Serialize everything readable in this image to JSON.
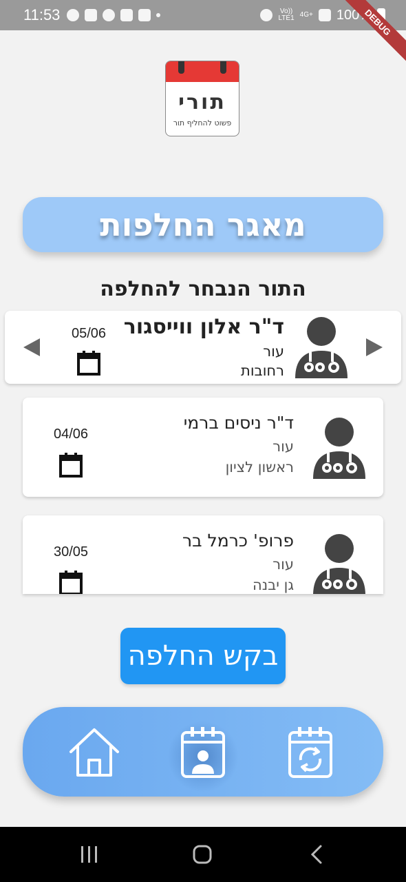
{
  "status_bar": {
    "time": "11:53",
    "battery": "100%",
    "network_top": "Vo))",
    "network_bottom": "LTE1",
    "network_type": "4G+"
  },
  "debug_banner": "DEBUG",
  "logo": {
    "text": "תורי",
    "tagline": "פשוט להחליף תור"
  },
  "title": "מאגר החלפות",
  "selected_heading": "התור הנבחר להחלפה",
  "selected_appointment": {
    "doctor": "ד\"ר אלון ווייסגור",
    "specialty": "עור",
    "city": "רחובות",
    "date": "05/06"
  },
  "appointments": [
    {
      "doctor": "ד\"ר ניסים ברמי",
      "specialty": "עור",
      "city": "ראשון לציון",
      "date": "04/06"
    },
    {
      "doctor": "פרופ' כרמל בר",
      "specialty": "עור",
      "city": "גן יבנה",
      "date": "30/05"
    }
  ],
  "request_button": "בקש החלפה",
  "bottom_nav": {
    "items": [
      {
        "icon": "home-icon"
      },
      {
        "icon": "calendar-person-icon",
        "active": true
      },
      {
        "icon": "calendar-swap-icon"
      }
    ]
  },
  "colors": {
    "accent": "#2196f3",
    "title_pill": "#9ec9f8",
    "nav_gradient_start": "#6aa8ef",
    "nav_gradient_end": "#84bcf5"
  }
}
